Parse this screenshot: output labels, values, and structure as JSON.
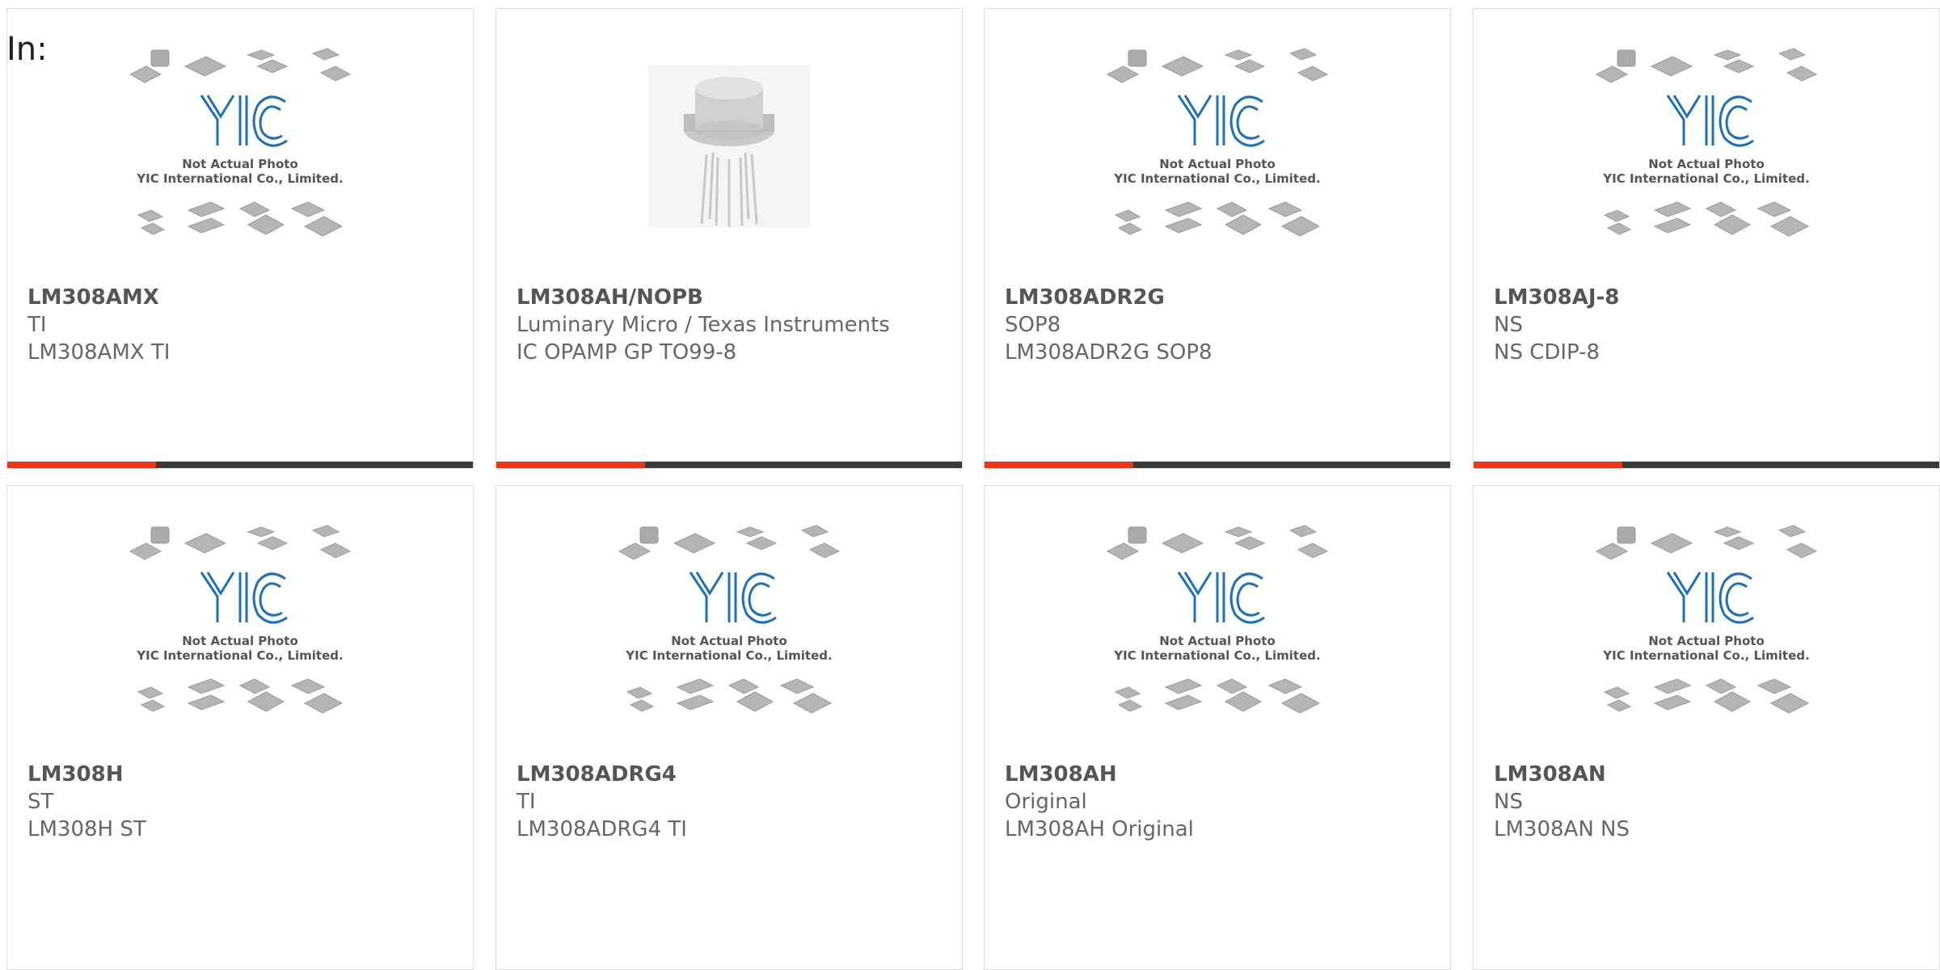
{
  "heading": "In:",
  "photo_caption": {
    "line1": "Not Actual Photo",
    "line2": "YIC International Co., Limited.",
    "logo": "YIC"
  },
  "accent_colors": {
    "bar_accent": "#e5391a",
    "bar_dark": "#3a3a3a",
    "logo_blue": "#1f6fb4"
  },
  "products": [
    {
      "part": "LM308AMX",
      "maker": "TI",
      "desc": "LM308AMX TI",
      "image": "placeholder"
    },
    {
      "part": "LM308AH/NOPB",
      "maker": "Luminary Micro / Texas Instruments",
      "desc": "IC OPAMP GP TO99-8",
      "image": "to99-can"
    },
    {
      "part": "LM308ADR2G",
      "maker": "SOP8",
      "desc": "LM308ADR2G SOP8",
      "image": "placeholder"
    },
    {
      "part": "LM308AJ-8",
      "maker": "NS",
      "desc": "NS CDIP-8",
      "image": "placeholder"
    },
    {
      "part": "LM308H",
      "maker": "ST",
      "desc": "LM308H ST",
      "image": "placeholder"
    },
    {
      "part": "LM308ADRG4",
      "maker": "TI",
      "desc": "LM308ADRG4 TI",
      "image": "placeholder"
    },
    {
      "part": "LM308AH",
      "maker": "Original",
      "desc": "LM308AH Original",
      "image": "placeholder"
    },
    {
      "part": "LM308AN",
      "maker": "NS",
      "desc": "LM308AN NS",
      "image": "placeholder"
    }
  ]
}
